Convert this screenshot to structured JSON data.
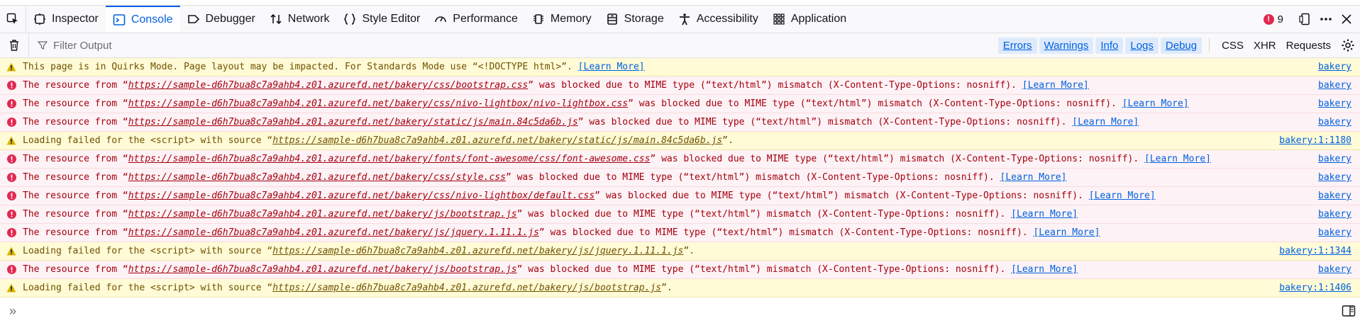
{
  "toolbar": {
    "tabs": [
      {
        "label": "Inspector",
        "icon": "inspector-icon"
      },
      {
        "label": "Console",
        "icon": "console-icon",
        "selected": true
      },
      {
        "label": "Debugger",
        "icon": "debugger-icon"
      },
      {
        "label": "Network",
        "icon": "network-icon"
      },
      {
        "label": "Style Editor",
        "icon": "style-editor-icon"
      },
      {
        "label": "Performance",
        "icon": "performance-icon"
      },
      {
        "label": "Memory",
        "icon": "memory-icon"
      },
      {
        "label": "Storage",
        "icon": "storage-icon"
      },
      {
        "label": "Accessibility",
        "icon": "accessibility-icon"
      },
      {
        "label": "Application",
        "icon": "application-icon"
      }
    ],
    "error_count": "9"
  },
  "filter": {
    "placeholder": "Filter Output",
    "levels": [
      "Errors",
      "Warnings",
      "Info",
      "Logs",
      "Debug"
    ],
    "network": [
      "CSS",
      "XHR",
      "Requests"
    ]
  },
  "messages": [
    {
      "level": "warning",
      "pre": "This page is in Quirks Mode. Page layout may be impacted. For Standards Mode use “<!DOCTYPE html>”. ",
      "url": "",
      "post": "",
      "learn": "[Learn More]",
      "loc": "bakery"
    },
    {
      "level": "error",
      "pre": "The resource from “",
      "url": "https://sample-d6h7bua8c7a9ahb4.z01.azurefd.net/bakery/css/bootstrap.css",
      "post": "” was blocked due to MIME type (“text/html”) mismatch (X-Content-Type-Options: nosniff). ",
      "learn": "[Learn More]",
      "loc": "bakery"
    },
    {
      "level": "error",
      "pre": "The resource from “",
      "url": "https://sample-d6h7bua8c7a9ahb4.z01.azurefd.net/bakery/css/nivo-lightbox/nivo-lightbox.css",
      "post": "” was blocked due to MIME type (“text/html”) mismatch (X-Content-Type-Options: nosniff). ",
      "learn": "[Learn More]",
      "loc": "bakery"
    },
    {
      "level": "error",
      "pre": "The resource from “",
      "url": "https://sample-d6h7bua8c7a9ahb4.z01.azurefd.net/bakery/static/js/main.84c5da6b.js",
      "post": "” was blocked due to MIME type (“text/html”) mismatch (X-Content-Type-Options: nosniff). ",
      "learn": "[Learn More]",
      "loc": "bakery"
    },
    {
      "level": "warning",
      "pre": "Loading failed for the <script> with source “",
      "url": "https://sample-d6h7bua8c7a9ahb4.z01.azurefd.net/bakery/static/js/main.84c5da6b.js",
      "post": "”.",
      "learn": "",
      "loc": "bakery:1:1180"
    },
    {
      "level": "error",
      "pre": "The resource from “",
      "url": "https://sample-d6h7bua8c7a9ahb4.z01.azurefd.net/bakery/fonts/font-awesome/css/font-awesome.css",
      "post": "” was blocked due to MIME type (“text/html”) mismatch (X-Content-Type-Options: nosniff). ",
      "learn": "[Learn More]",
      "loc": "bakery"
    },
    {
      "level": "error",
      "pre": "The resource from “",
      "url": "https://sample-d6h7bua8c7a9ahb4.z01.azurefd.net/bakery/css/style.css",
      "post": "” was blocked due to MIME type (“text/html”) mismatch (X-Content-Type-Options: nosniff). ",
      "learn": "[Learn More]",
      "loc": "bakery"
    },
    {
      "level": "error",
      "pre": "The resource from “",
      "url": "https://sample-d6h7bua8c7a9ahb4.z01.azurefd.net/bakery/css/nivo-lightbox/default.css",
      "post": "” was blocked due to MIME type (“text/html”) mismatch (X-Content-Type-Options: nosniff). ",
      "learn": "[Learn More]",
      "loc": "bakery"
    },
    {
      "level": "error",
      "pre": "The resource from “",
      "url": "https://sample-d6h7bua8c7a9ahb4.z01.azurefd.net/bakery/js/bootstrap.js",
      "post": "” was blocked due to MIME type (“text/html”) mismatch (X-Content-Type-Options: nosniff). ",
      "learn": "[Learn More]",
      "loc": "bakery"
    },
    {
      "level": "error",
      "pre": "The resource from “",
      "url": "https://sample-d6h7bua8c7a9ahb4.z01.azurefd.net/bakery/js/jquery.1.11.1.js",
      "post": "” was blocked due to MIME type (“text/html”) mismatch (X-Content-Type-Options: nosniff). ",
      "learn": "[Learn More]",
      "loc": "bakery"
    },
    {
      "level": "warning",
      "pre": "Loading failed for the <script> with source “",
      "url": "https://sample-d6h7bua8c7a9ahb4.z01.azurefd.net/bakery/js/jquery.1.11.1.js",
      "post": "”.",
      "learn": "",
      "loc": "bakery:1:1344"
    },
    {
      "level": "error",
      "pre": "The resource from “",
      "url": "https://sample-d6h7bua8c7a9ahb4.z01.azurefd.net/bakery/js/bootstrap.js",
      "post": "” was blocked due to MIME type (“text/html”) mismatch (X-Content-Type-Options: nosniff). ",
      "learn": "[Learn More]",
      "loc": "bakery"
    },
    {
      "level": "warning",
      "pre": "Loading failed for the <script> with source “",
      "url": "https://sample-d6h7bua8c7a9ahb4.z01.azurefd.net/bakery/js/bootstrap.js",
      "post": "”.",
      "learn": "",
      "loc": "bakery:1:1406"
    }
  ],
  "colors": {
    "accent": "#0061e0",
    "error_bg": "#fdf2f5",
    "error_text": "#a4000f",
    "warning_bg": "#fffbd6",
    "warning_text": "#715100",
    "error_icon": "#e22850",
    "warning_icon": "#d7b600"
  }
}
